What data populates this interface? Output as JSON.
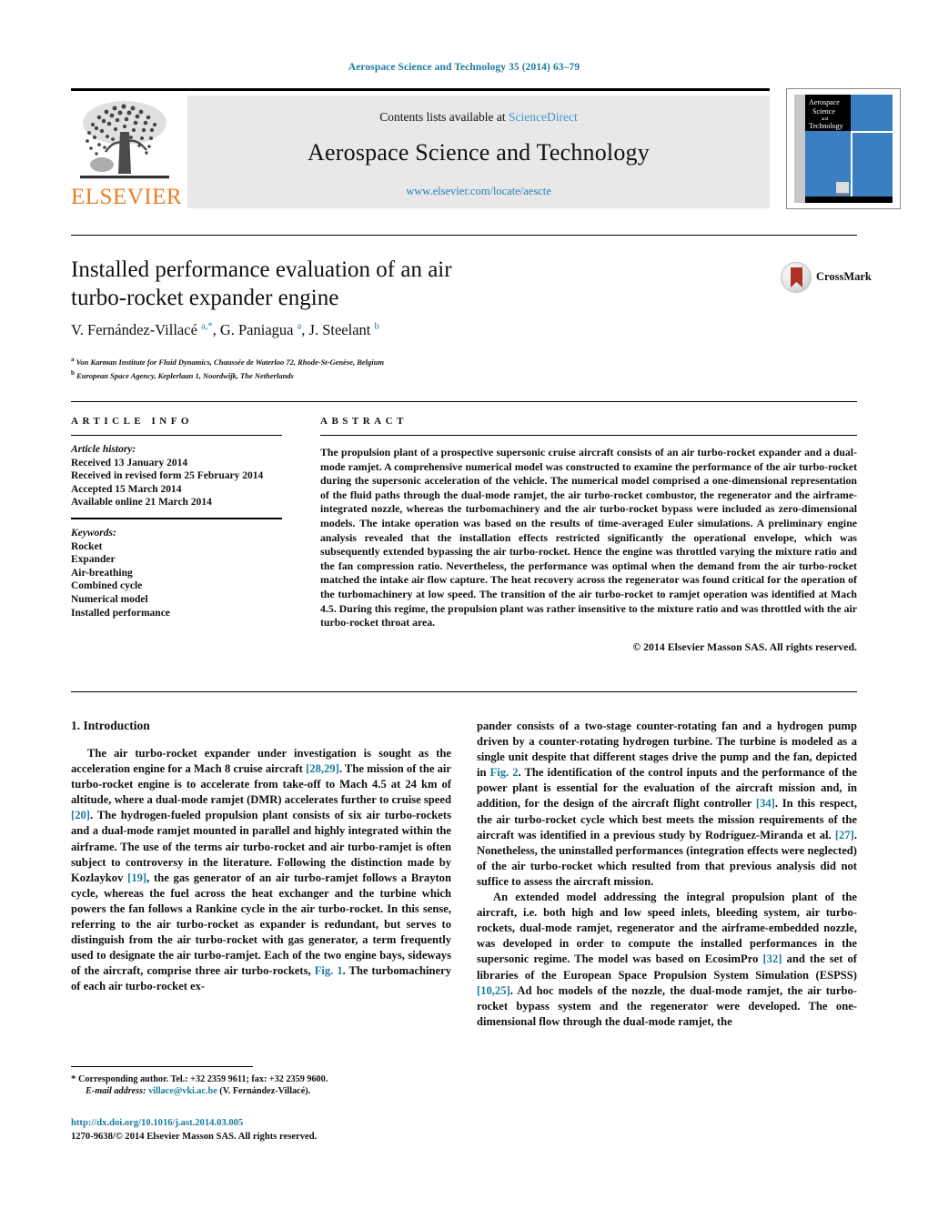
{
  "running_head": "Aerospace Science and Technology 35 (2014) 63–79",
  "masthead": {
    "contents_prefix": "Contents lists available at ",
    "sciencedirect": "ScienceDirect",
    "journal_title": "Aerospace Science and Technology",
    "journal_url": "www.elsevier.com/locate/aescte",
    "publisher_wordmark": "ELSEVIER",
    "cover_lines": [
      "Aerospace",
      "Science",
      "and",
      "Technology"
    ]
  },
  "article": {
    "title": "Installed performance evaluation of an air turbo-rocket expander engine",
    "title_line1": "Installed performance evaluation of an air",
    "title_line2": "turbo-rocket expander engine",
    "crossmark_label": "CrossMark",
    "authors_html": "V. Fernández-Villacé <sup>a,*</sup>, G. Paniagua <sup>a</sup>, J. Steelant <sup>b</sup>",
    "affiliation_a": "Von Karman Institute for Fluid Dynamics, Chaussée de Waterloo 72, Rhode-St-Genèse, Belgium",
    "affiliation_b": "European Space Agency, Keplerlaan 1, Noordwijk, The Netherlands"
  },
  "info": {
    "heading": "ARTICLE INFO",
    "history_label": "Article history:",
    "history": [
      "Received 13 January 2014",
      "Received in revised form 25 February 2014",
      "Accepted 15 March 2014",
      "Available online 21 March 2014"
    ],
    "keywords_label": "Keywords:",
    "keywords": [
      "Rocket",
      "Expander",
      "Air-breathing",
      "Combined cycle",
      "Numerical model",
      "Installed performance"
    ]
  },
  "abstract": {
    "heading": "ABSTRACT",
    "text": "The propulsion plant of a prospective supersonic cruise aircraft consists of an air turbo-rocket expander and a dual-mode ramjet. A comprehensive numerical model was constructed to examine the performance of the air turbo-rocket during the supersonic acceleration of the vehicle. The numerical model comprised a one-dimensional representation of the fluid paths through the dual-mode ramjet, the air turbo-rocket combustor, the regenerator and the airframe-integrated nozzle, whereas the turbomachinery and the air turbo-rocket bypass were included as zero-dimensional models. The intake operation was based on the results of time-averaged Euler simulations. A preliminary engine analysis revealed that the installation effects restricted significantly the operational envelope, which was subsequently extended bypassing the air turbo-rocket. Hence the engine was throttled varying the mixture ratio and the fan compression ratio. Nevertheless, the performance was optimal when the demand from the air turbo-rocket matched the intake air flow capture. The heat recovery across the regenerator was found critical for the operation of the turbomachinery at low speed. The transition of the air turbo-rocket to ramjet operation was identified at Mach 4.5. During this regime, the propulsion plant was rather insensitive to the mixture ratio and was throttled with the air turbo-rocket throat area.",
    "copyright": "© 2014 Elsevier Masson SAS. All rights reserved."
  },
  "body": {
    "section_heading": "1. Introduction",
    "left_paragraph_1_html": "The air turbo-rocket expander under investigation is sought as the acceleration engine for a Mach 8 cruise aircraft <span class=\"ref\">[28,29]</span>. The mission of the air turbo-rocket engine is to accelerate from take-off to Mach 4.5 at 24 km of altitude, where a dual-mode ramjet (DMR) accelerates further to cruise speed <span class=\"ref\">[20]</span>. The hydrogen-fueled propulsion plant consists of six air turbo-rockets and a dual-mode ramjet mounted in parallel and highly integrated within the airframe. The use of the terms air turbo-rocket and air turbo-ramjet is often subject to controversy in the literature. Following the distinction made by Kozlaykov <span class=\"ref\">[19]</span>, the gas generator of an air turbo-ramjet follows a Brayton cycle, whereas the fuel across the heat exchanger and the turbine which powers the fan follows a Rankine cycle in the air turbo-rocket. In this sense, referring to the air turbo-rocket as expander is redundant, but serves to distinguish from the air turbo-rocket with gas generator, a term frequently used to designate the air turbo-ramjet. Each of the two engine bays, sideways of the aircraft, comprise three air turbo-rockets, <span class=\"ref\">Fig. 1</span>. The turbomachinery of each air turbo-rocket ex-",
    "right_paragraph_1_html": "pander consists of a two-stage counter-rotating fan and a hydrogen pump driven by a counter-rotating hydrogen turbine. The turbine is modeled as a single unit despite that different stages drive the pump and the fan, depicted in <span class=\"ref\">Fig. 2</span>. The identification of the control inputs and the performance of the power plant is essential for the evaluation of the aircraft mission and, in addition, for the design of the aircraft flight controller <span class=\"ref\">[34]</span>. In this respect, the air turbo-rocket cycle which best meets the mission requirements of the aircraft was identified in a previous study by Rodríguez-Miranda et al. <span class=\"ref\">[27]</span>. Nonetheless, the uninstalled performances (integration effects were neglected) of the air turbo-rocket which resulted from that previous analysis did not suffice to assess the aircraft mission.",
    "right_paragraph_2_html": "An extended model addressing the integral propulsion plant of the aircraft, i.e. both high and low speed inlets, bleeding system, air turbo-rockets, dual-mode ramjet, regenerator and the airframe-embedded nozzle, was developed in order to compute the installed performances in the supersonic regime. The model was based on EcosimPro <span class=\"ref\">[32]</span> and the set of libraries of the European Space Propulsion System Simulation (ESPSS) <span class=\"ref\">[10,25]</span>. Ad hoc models of the nozzle, the dual-mode ramjet, the air turbo-rocket bypass system and the regenerator were developed. The one-dimensional flow through the dual-mode ramjet, the"
  },
  "footer": {
    "corresponding_star": "*",
    "corresponding_author": "Corresponding author. Tel.: +32 2359 9611; fax: +32 2359 9600.",
    "email_label": "E-mail address:",
    "email": "villace@vki.ac.be",
    "email_owner": "(V. Fernández-Villacé).",
    "doi": "http://dx.doi.org/10.1016/j.ast.2014.03.005",
    "issn_line": "1270-9638/© 2014 Elsevier Masson SAS. All rights reserved."
  },
  "colors": {
    "link_blue": "#1a7b9e",
    "sciencedirect_blue": "#4d93c6",
    "elsevier_orange": "#ef7d22",
    "cover_blue": "#3a7fc1",
    "crossmark_red": "#b03023"
  }
}
